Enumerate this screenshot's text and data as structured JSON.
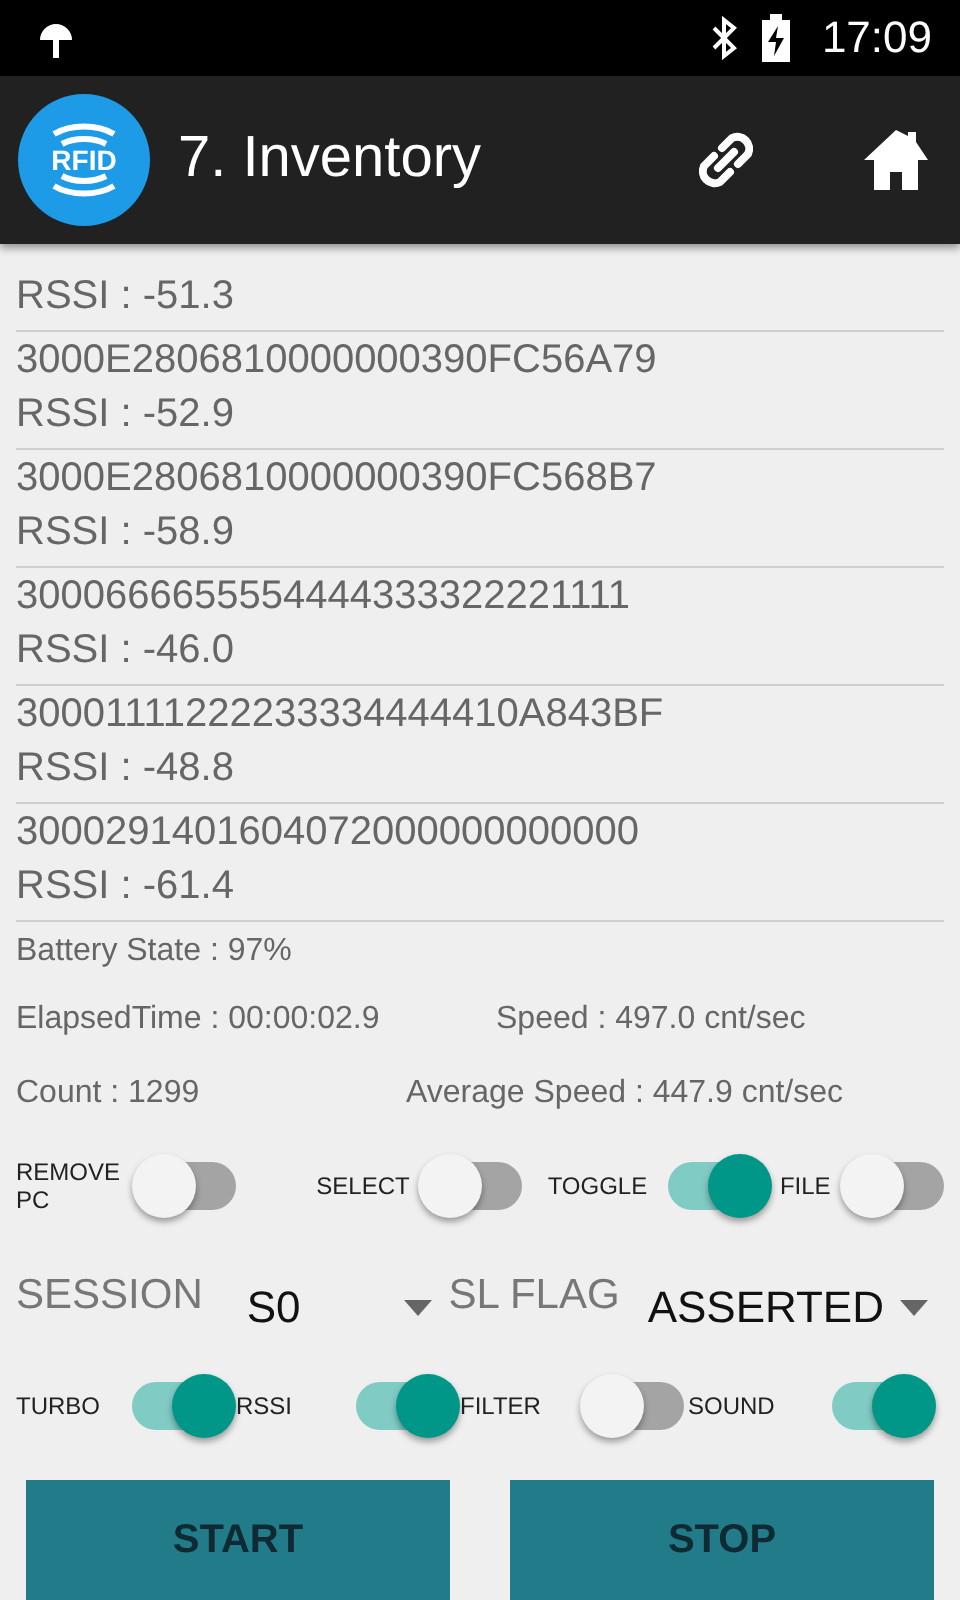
{
  "status_bar": {
    "time": "17:09"
  },
  "app_bar": {
    "logo": "RFID",
    "title": "7. Inventory"
  },
  "tags": [
    {
      "rssi": "RSSI : -51.3"
    },
    {
      "epc": "3000E2806810000000390FC56A79",
      "rssi": "RSSI : -52.9"
    },
    {
      "epc": "3000E2806810000000390FC568B7",
      "rssi": "RSSI : -58.9"
    },
    {
      "epc": "3000666655554444333322221111",
      "rssi": "RSSI : -46.0"
    },
    {
      "epc": "30001111222233334444410A843BF",
      "rssi": "RSSI : -48.8"
    },
    {
      "epc": "3000291401604072000000000000",
      "rssi": "RSSI : -61.4"
    }
  ],
  "battery": "Battery State : 97%",
  "elapsed": "ElapsedTime : 00:00:02.9",
  "speed": "Speed : 497.0 cnt/sec",
  "count": "Count : 1299",
  "average_speed": "Average Speed : 447.9 cnt/sec",
  "switches_row_1": [
    {
      "label": "REMOVE PC",
      "on": false
    },
    {
      "label": "SELECT",
      "on": false
    },
    {
      "label": "TOGGLE",
      "on": true
    },
    {
      "label": "FILE",
      "on": false
    }
  ],
  "spinners": [
    {
      "label": "SESSION",
      "value": "S0"
    },
    {
      "label": "SL FLAG",
      "value": "ASSERTED"
    }
  ],
  "switches_row_2": [
    {
      "label": "TURBO",
      "on": true
    },
    {
      "label": "RSSI",
      "on": true
    },
    {
      "label": "FILTER",
      "on": false
    },
    {
      "label": "SOUND",
      "on": true
    }
  ],
  "buttons": [
    "START",
    "STOP"
  ]
}
